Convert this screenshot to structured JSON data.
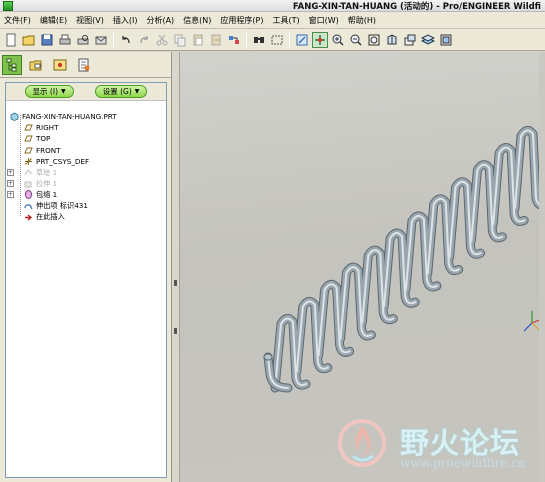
{
  "window": {
    "title": "FANG-XIN-TAN-HUANG (活动的) - Pro/ENGINEER Wildfi"
  },
  "menu": [
    {
      "label": "文件(F)",
      "name": "menu-file"
    },
    {
      "label": "编辑(E)",
      "name": "menu-edit"
    },
    {
      "label": "视图(V)",
      "name": "menu-view"
    },
    {
      "label": "插入(I)",
      "name": "menu-insert"
    },
    {
      "label": "分析(A)",
      "name": "menu-analysis"
    },
    {
      "label": "信息(N)",
      "name": "menu-info"
    },
    {
      "label": "应用程序(P)",
      "name": "menu-applications"
    },
    {
      "label": "工具(T)",
      "name": "menu-tools"
    },
    {
      "label": "窗口(W)",
      "name": "menu-window"
    },
    {
      "label": "帮助(H)",
      "name": "menu-help"
    }
  ],
  "toolbar": {
    "icons": [
      "new-file-icon",
      "open-file-icon",
      "save-icon",
      "print-icon",
      "print-preview-icon",
      "email-icon",
      "undo-icon",
      "redo-icon",
      "cut-icon",
      "copy-icon",
      "paste-icon",
      "paste-special-icon",
      "regenerate-icon",
      "find-icon",
      "select-box-icon",
      "repaint-icon",
      "spin-center-icon",
      "zoom-in-icon",
      "zoom-out-icon",
      "refit-icon",
      "reorient-icon",
      "saved-views-icon",
      "layers-icon",
      "view-manager-icon"
    ]
  },
  "panel": {
    "show_button": "显示 (I)",
    "settings_button": "设置 (G)"
  },
  "tree": {
    "root": "FANG-XIN-TAN-HUANG.PRT",
    "items": [
      {
        "label": "RIGHT",
        "icon": "datum-plane-icon"
      },
      {
        "label": "TOP",
        "icon": "datum-plane-icon"
      },
      {
        "label": "FRONT",
        "icon": "datum-plane-icon"
      },
      {
        "label": "PRT_CSYS_DEF",
        "icon": "coordinate-system-icon"
      },
      {
        "label": "草绘 1",
        "icon": "sketch-icon",
        "dim": true
      },
      {
        "label": "拉伸 1",
        "icon": "extrude-icon",
        "dim": true
      },
      {
        "label": "包络 1",
        "icon": "wrap-icon"
      },
      {
        "label": "伸出项 标识431",
        "icon": "protrusion-icon"
      },
      {
        "label": "在此插入",
        "icon": "insert-here-icon"
      }
    ]
  },
  "watermark": {
    "text": "野火论坛",
    "url": "www.proewildfire.cn"
  },
  "colors": {
    "accent_green": "#8fd84c",
    "tree_background": "#ffffff",
    "viewport_background": "#c6c5bf",
    "part_color": "#9aa6ae"
  }
}
